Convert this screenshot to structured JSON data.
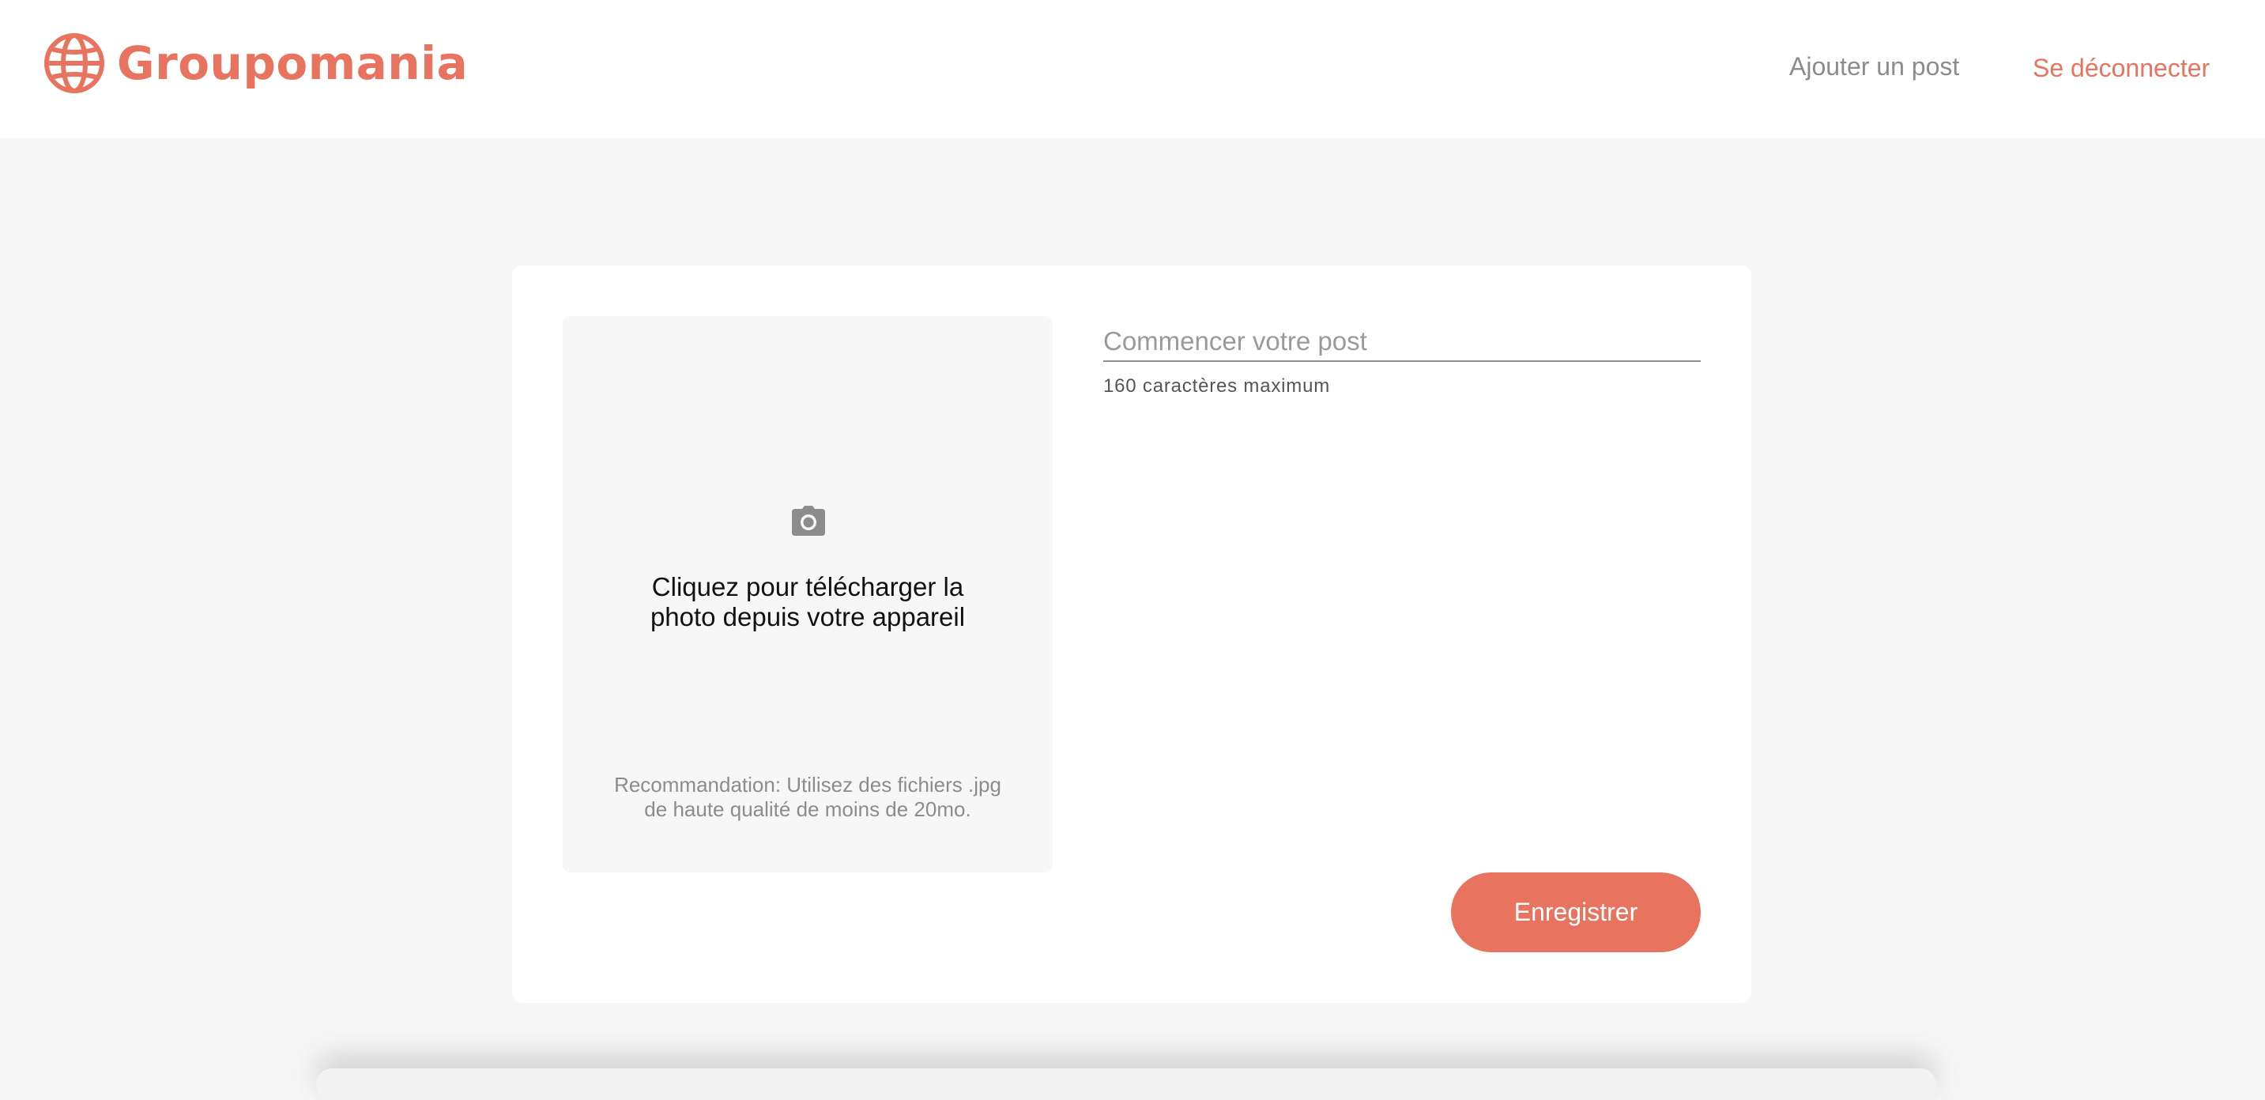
{
  "header": {
    "logo_text": "Groupomania",
    "logo_icon": "globe-icon",
    "nav": {
      "add_post": "Ajouter un post",
      "logout": "Se déconnecter"
    }
  },
  "form": {
    "upload": {
      "icon": "camera-icon",
      "label_line1": "Cliquez pour télécharger la",
      "label_line2": "photo depuis votre appareil",
      "hint_line1": "Recommandation: Utilisez des fichiers .jpg",
      "hint_line2": "de haute qualité de moins de 20mo."
    },
    "post_placeholder": "Commencer votre post",
    "post_value": "",
    "char_hint": "160 caractères maximum",
    "save_label": "Enregistrer"
  },
  "colors": {
    "brand": "#e8735f",
    "page_background": "#f7f7f7",
    "muted_text": "#8c8c8c"
  }
}
